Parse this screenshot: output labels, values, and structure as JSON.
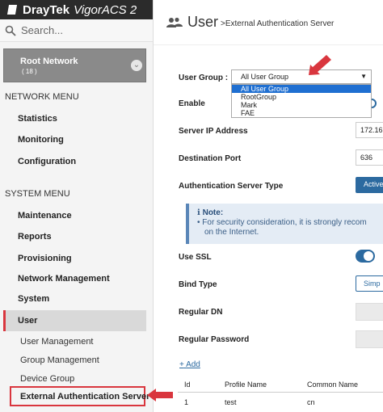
{
  "app": {
    "brand": "DrayTek",
    "product": "VigorACS 2"
  },
  "search": {
    "placeholder": "Search..."
  },
  "root": {
    "title": "Root Network",
    "count": "( 18 )"
  },
  "network_menu": {
    "header": "NETWORK MENU",
    "items": [
      "Statistics",
      "Monitoring",
      "Configuration"
    ]
  },
  "system_menu": {
    "header": "SYSTEM MENU",
    "items": [
      "Maintenance",
      "Reports",
      "Provisioning",
      "Network Management",
      "System"
    ]
  },
  "user_menu": {
    "label": "User",
    "subitems": [
      "User Management",
      "Group Management",
      "Device Group",
      "External Authentication Server"
    ]
  },
  "page": {
    "title": "User",
    "subtitle": ">External Authentication Server"
  },
  "form": {
    "user_group_label": "User Group :",
    "user_group_value": "All User Group",
    "user_group_options": [
      "All User Group",
      "RootGroup",
      "Mark",
      "FAE"
    ],
    "enable_label": "Enable",
    "server_ip_label": "Server IP Address",
    "server_ip_value": "172.16.",
    "dest_port_label": "Destination Port",
    "dest_port_value": "636",
    "auth_type_label": "Authentication Server Type",
    "auth_type_value": "Active",
    "note_title": "Note:",
    "note_text_1": "For security consideration, it is strongly recom",
    "note_text_2": "on the Internet.",
    "use_ssl_label": "Use SSL",
    "bind_type_label": "Bind Type",
    "bind_type_value": "Simp",
    "regular_dn_label": "Regular DN",
    "regular_pw_label": "Regular Password"
  },
  "table": {
    "add_label": "Add",
    "columns": [
      "Id",
      "Profile Name",
      "Common Name"
    ],
    "rows": [
      {
        "id": "1",
        "profile": "test",
        "common": "cn"
      }
    ]
  },
  "colors": {
    "accent": "#2c6aa0",
    "highlight": "#d9363e",
    "sidebar": "#f4f4f4",
    "selected_option": "#1f6fd1"
  }
}
